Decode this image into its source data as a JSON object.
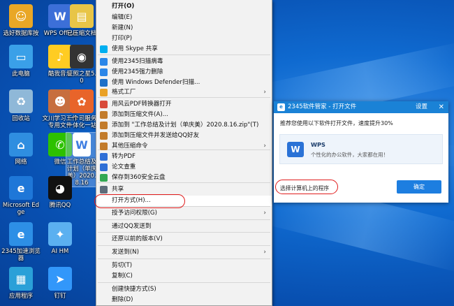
{
  "desktop_icons": [
    {
      "label": "选好数据库按",
      "icon": "person-icon",
      "color": "#e9a726"
    },
    {
      "label": "WPS Office",
      "icon": "wps-icon",
      "color": "#3c6fd8"
    },
    {
      "label": "已压缩文档",
      "icon": "folder-zip-icon",
      "color": "#e8c547"
    },
    {
      "label": "此电脑",
      "icon": "computer-icon",
      "color": "#3aa0e8"
    },
    {
      "label": "酷我音乐",
      "icon": "music-icon",
      "color": "#ffcc22"
    },
    {
      "label": "证照之星5.0",
      "icon": "camera-icon",
      "color": "#333333"
    },
    {
      "label": "回收站",
      "icon": "recycle-bin-icon",
      "color": "#8fb8d8"
    },
    {
      "label": "文川学习工作专用文件",
      "icon": "photo-icon",
      "color": "#c76e3e"
    },
    {
      "label": "一个司服务一体化一站",
      "icon": "mascot-icon",
      "color": "#e8642a"
    },
    {
      "label": "网络",
      "icon": "network-icon",
      "color": "#2f8ee0"
    },
    {
      "label": "微信",
      "icon": "wechat-icon",
      "color": "#2dc100"
    },
    {
      "label": "工作总结及计划（单庆美）2020.8.16",
      "icon": "doc-icon",
      "color": "#3f7ee2"
    },
    {
      "label": "Microsoft Edge",
      "icon": "edge-icon",
      "color": "#1e77d8"
    },
    {
      "label": "腾讯QQ",
      "icon": "qq-icon",
      "color": "#111111"
    },
    {
      "label": "2345加速浏览器",
      "icon": "ie-icon",
      "color": "#2d8fe6"
    },
    {
      "label": "AI HM",
      "icon": "ai-icon",
      "color": "#5bb0f0"
    },
    {
      "label": "应用程序",
      "icon": "apps-icon",
      "color": "#2aa0d8"
    },
    {
      "label": "钉钉",
      "icon": "dingtalk-icon",
      "color": "#3297fa"
    }
  ],
  "context_menu": {
    "items": [
      {
        "label": "打开(O)",
        "bold": true
      },
      {
        "label": "编辑(E)"
      },
      {
        "label": "新建(N)"
      },
      {
        "label": "打印(P)"
      },
      {
        "label": "使用 Skype 共享",
        "icon": "skype-icon"
      },
      {
        "label": "使用2345扫描病毒",
        "icon": "scan-icon"
      },
      {
        "label": "使用2345强力删除",
        "icon": "delete-icon"
      },
      {
        "label": "使用 Windows Defender扫描...",
        "icon": "defender-icon"
      },
      {
        "label": "格式工厂",
        "icon": "format-factory-icon",
        "submenu": true
      },
      {
        "label": "用风云PDF转换器打开",
        "icon": "pdf-icon"
      },
      {
        "label": "添加到压缩文件(A)...",
        "icon": "archive-icon"
      },
      {
        "label": "添加到 \"工作总结及计划（单庆美）2020.8.16.zip\"(T)",
        "icon": "archive-icon"
      },
      {
        "label": "添加到压缩文件并发送给QQ好友",
        "icon": "archive-icon"
      },
      {
        "label": "其他压缩命令",
        "icon": "archive-icon",
        "submenu": true
      },
      {
        "label": "转为PDF",
        "icon": "wps-icon"
      },
      {
        "label": "论文查重",
        "icon": "wps-icon"
      },
      {
        "label": "保存到360安全云盘",
        "icon": "cloud-icon"
      },
      {
        "label": "共享",
        "icon": "share-icon"
      },
      {
        "label": "打开方式(H)...",
        "highlighted": true
      },
      {
        "label": "授予访问权限(G)",
        "submenu": true
      },
      {
        "label": "通过QQ发送到"
      },
      {
        "label": "还原以前的版本(V)"
      },
      {
        "label": "发送到(N)",
        "submenu": true
      },
      {
        "label": "剪切(T)"
      },
      {
        "label": "复制(C)"
      },
      {
        "label": "创建快捷方式(S)"
      },
      {
        "label": "删除(D)"
      }
    ]
  },
  "dialog": {
    "title": "2345软件管家 - 打开文件",
    "settings": "设置",
    "close": "✕",
    "tip": "推荐您使用以下软件打开文件，速度提升30%",
    "app_name": "WPS",
    "app_desc": "个性化的办公软件，大家都在用！",
    "choose": "选择计算机上的程序",
    "ok": "确定"
  },
  "colors": {
    "annotation": "#e01c1c",
    "dialog_title_bg": "#1a82d6",
    "ok_button": "#1d7ee0"
  }
}
